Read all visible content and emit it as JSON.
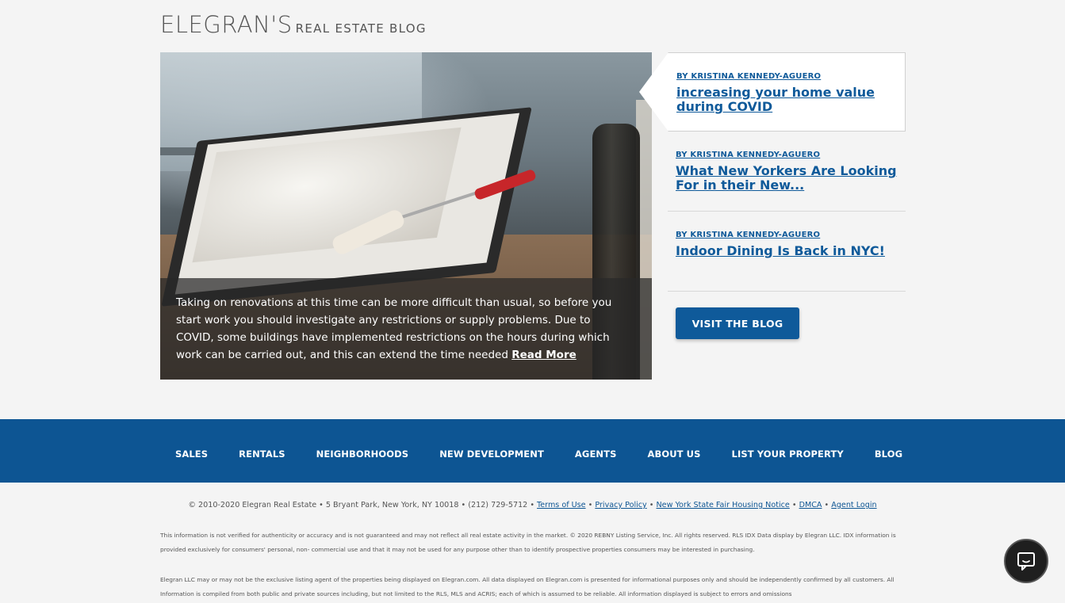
{
  "header": {
    "brand_main": "ELEGRAN'S",
    "brand_sub": "REAL ESTATE BLOG"
  },
  "hero": {
    "caption": "Taking on renovations at this time can be more difficult than usual, so before you start work you should investigate any restrictions or supply problems. Due to COVID, some buildings have implemented restrictions on the hours during which work can be carried out, and this can extend the time needed",
    "read_more": "Read More"
  },
  "posts": [
    {
      "author": "BY KRISTINA KENNEDY-AGUERO",
      "title": "increasing your home value during COVID"
    },
    {
      "author": "BY KRISTINA KENNEDY-AGUERO",
      "title": "What New Yorkers Are Looking For in their New..."
    },
    {
      "author": "BY KRISTINA KENNEDY-AGUERO",
      "title": "Indoor Dining Is Back in NYC!"
    }
  ],
  "visit_button": "VISIT THE BLOG",
  "footer_nav": [
    "SALES",
    "RENTALS",
    "NEIGHBORHOODS",
    "NEW DEVELOPMENT",
    "AGENTS",
    "ABOUT US",
    "LIST YOUR PROPERTY",
    "BLOG"
  ],
  "footer": {
    "copyright": "© 2010-2020 Elegran Real Estate • 5 Bryant Park, New York, NY 10018 • (212) 729-5712 •",
    "links": [
      "Terms of Use",
      "Privacy Policy",
      "New York State Fair Housing Notice",
      "DMCA",
      "Agent Login"
    ],
    "disclaimer_1": "This information is not verified for authenticity or accuracy and is not guaranteed and may not reflect all real estate activity in the market. © 2020 REBNY Listing Service, Inc. All rights reserved. RLS IDX Data display by Elegran LLC. IDX information is provided exclusively for consumers' personal, non- commercial use and that it may not be used for any purpose other than to identify prospective properties consumers may be interested in purchasing.",
    "disclaimer_2": "Elegran LLC may or may not be the exclusive listing agent of the properties being displayed on Elegran.com. All data displayed on Elegran.com is presented for informational purposes only and should be independently confirmed by all customers. All Information is compiled from both public and private sources including, but not limited to the RLS, MLS and ACRIS; each of which is assumed to be reliable. All information displayed is subject to errors and omissions"
  },
  "chat_icon": "chat-bubble-icon"
}
